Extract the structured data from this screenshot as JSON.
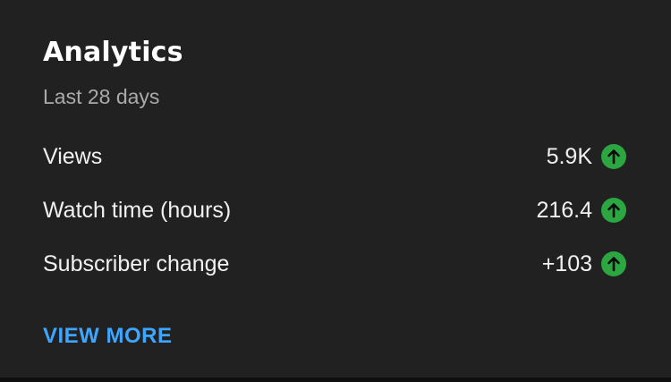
{
  "card": {
    "title": "Analytics",
    "subtitle": "Last 28 days",
    "metrics": [
      {
        "label": "Views",
        "value": "5.9K",
        "trend_icon": "arrow-up-circle-icon"
      },
      {
        "label": "Watch time (hours)",
        "value": "216.4",
        "trend_icon": "arrow-up-circle-icon"
      },
      {
        "label": "Subscriber change",
        "value": "+103",
        "trend_icon": "arrow-up-circle-icon"
      }
    ],
    "view_more_label": "VIEW MORE"
  },
  "colors": {
    "background": "#212121",
    "text_primary": "#f1f1f1",
    "text_secondary": "#aaaaaa",
    "trend_up": "#2ba640",
    "link": "#3ea6ff"
  }
}
